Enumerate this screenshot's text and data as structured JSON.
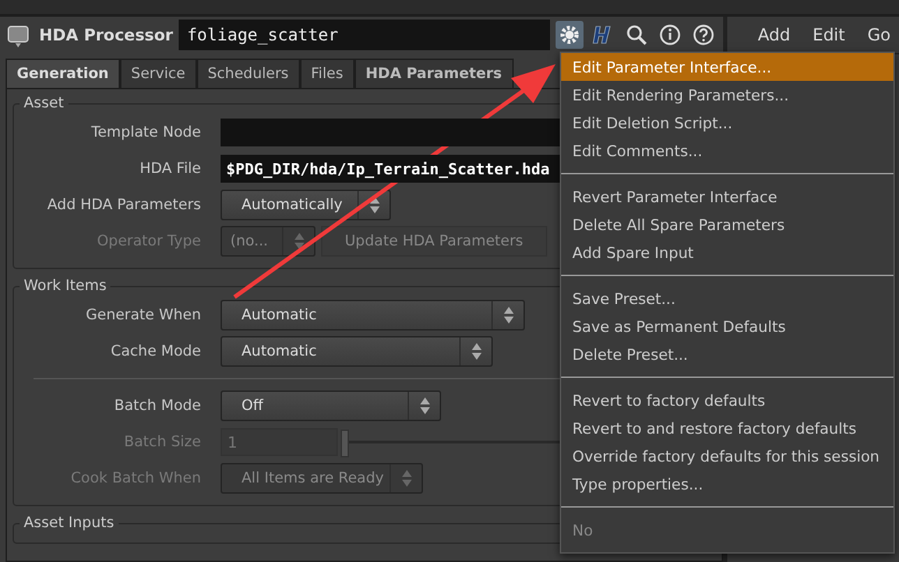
{
  "header": {
    "node_type": "HDA Processor",
    "node_name": "foliage_scatter",
    "tools": [
      {
        "kind": "gear",
        "selected": true
      },
      {
        "kind": "houdini",
        "selected": false
      },
      {
        "kind": "search",
        "selected": false
      },
      {
        "kind": "info",
        "selected": false
      },
      {
        "kind": "help",
        "selected": false
      }
    ]
  },
  "pane_menu": [
    "Add",
    "Edit",
    "Go"
  ],
  "tabs": [
    {
      "label": "Generation",
      "selected": true,
      "bold": true
    },
    {
      "label": "Service",
      "selected": false,
      "bold": false
    },
    {
      "label": "Schedulers",
      "selected": false,
      "bold": false
    },
    {
      "label": "Files",
      "selected": false,
      "bold": false
    },
    {
      "label": "HDA Parameters",
      "selected": false,
      "bold": true
    }
  ],
  "sections": [
    {
      "title": "Asset",
      "rows": [
        {
          "kind": "field",
          "label": "Template Node",
          "value": "",
          "disabled": false
        },
        {
          "kind": "field",
          "label": "HDA File",
          "value": "$PDG_DIR/hda/Ip_Terrain_Scatter.hda",
          "disabled": false
        },
        {
          "kind": "menu",
          "label": "Add HDA Parameters",
          "value": "Automatically",
          "disabled": false
        },
        {
          "kind": "operator",
          "label": "Operator Type",
          "value": "(no...",
          "button": "Update HDA Parameters",
          "disabled": true
        }
      ]
    },
    {
      "title": "Work Items",
      "rows": [
        {
          "kind": "menu",
          "label": "Generate When",
          "value": "Automatic",
          "disabled": false
        },
        {
          "kind": "menu",
          "label": "Cache Mode",
          "value": "Automatic",
          "disabled": false
        },
        {
          "kind": "separator"
        },
        {
          "kind": "menu",
          "label": "Batch Mode",
          "value": "Off",
          "disabled": false
        },
        {
          "kind": "slider",
          "label": "Batch Size",
          "value": "1",
          "disabled": true,
          "level": 0
        },
        {
          "kind": "menu",
          "label": "Cook Batch When",
          "value": "All Items are Ready",
          "disabled": true
        }
      ]
    },
    {
      "title": "Asset Inputs"
    }
  ],
  "context_menu": [
    [
      {
        "label": "Edit Parameter Interface...",
        "selected": true,
        "disabled": false
      },
      {
        "label": "Edit Rendering Parameters...",
        "selected": false,
        "disabled": false
      },
      {
        "label": "Edit Deletion Script...",
        "selected": false,
        "disabled": false
      },
      {
        "label": "Edit Comments...",
        "selected": false,
        "disabled": false
      }
    ],
    [
      {
        "label": "Revert Parameter Interface",
        "selected": false,
        "disabled": false
      },
      {
        "label": "Delete All Spare Parameters",
        "selected": false,
        "disabled": false
      },
      {
        "label": "Add Spare Input",
        "selected": false,
        "disabled": false
      }
    ],
    [
      {
        "label": "Save Preset...",
        "selected": false,
        "disabled": false
      },
      {
        "label": "Save as Permanent Defaults",
        "selected": false,
        "disabled": false
      },
      {
        "label": "Delete Preset...",
        "selected": false,
        "disabled": false
      }
    ],
    [
      {
        "label": "Revert to factory defaults",
        "selected": false,
        "disabled": false
      },
      {
        "label": "Revert to and restore factory defaults",
        "selected": false,
        "disabled": false
      },
      {
        "label": "Override factory defaults for this session",
        "selected": false,
        "disabled": false
      },
      {
        "label": "Type properties...",
        "selected": false,
        "disabled": false
      }
    ],
    [
      {
        "label": "No",
        "selected": false,
        "disabled": true
      }
    ]
  ]
}
